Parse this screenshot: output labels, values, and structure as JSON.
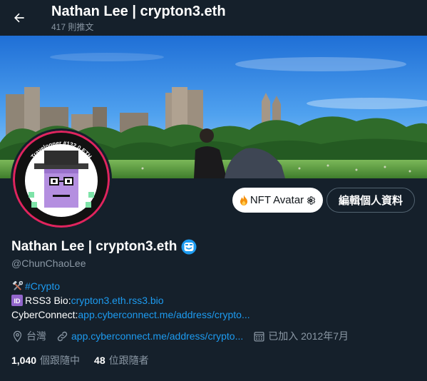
{
  "header": {
    "title": "Nathan Lee | crypton3.eth",
    "subtitle": "417 則推文",
    "back_icon": "arrow-left-icon"
  },
  "avatar": {
    "ring_text": "Travelogger #132 0 ETH",
    "ring_color": "#e0245e"
  },
  "actions": {
    "nft_label": "NFT Avatar",
    "edit_label": "編輯個人資料"
  },
  "profile": {
    "display_name": "Nathan Lee | crypton3.eth",
    "handle": "@ChunChaoLee",
    "badge_icon": "smiley-badge-icon"
  },
  "bio": {
    "line1_tag": "#Crypto",
    "line2_label": "RSS3 Bio: ",
    "line2_link": "crypton3.eth.rss3.bio",
    "line3_label": "CyberConnect: ",
    "line3_link": "app.cyberconnect.me/address/crypto..."
  },
  "meta": {
    "location": "台灣",
    "website": "app.cyberconnect.me/address/crypto...",
    "joined": "已加入 2012年7月"
  },
  "follow": {
    "following_count": "1,040",
    "following_label": "個跟隨中",
    "followers_count": "48",
    "followers_label": "位跟隨者"
  },
  "colors": {
    "background": "#15202b",
    "accent": "#1d9bf0",
    "secondary_text": "#8b98a5"
  }
}
